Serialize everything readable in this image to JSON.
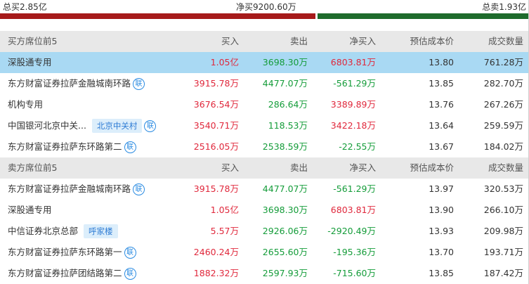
{
  "summary": {
    "total_buy": "总买2.85亿",
    "net_buy": "净买9200.60万",
    "total_sell": "总卖1.93亿",
    "buy_ratio": 0.596,
    "buy_color": "#a61a1a",
    "sell_color": "#1e6b2c"
  },
  "columns": {
    "buy": "买入",
    "sell": "卖出",
    "net": "净买入",
    "cost": "预估成本价",
    "vol": "成交数量"
  },
  "buy_section": {
    "title": "买方席位前5",
    "rows": [
      {
        "name": "深股通专用",
        "tag": "",
        "lian": false,
        "buy": "1.05亿",
        "sell": "3698.30万",
        "net": "6803.81万",
        "net_dir": "red",
        "cost": "13.80",
        "vol": "761.28万",
        "highlight": true
      },
      {
        "name": "东方财富证券拉萨金融城南环路",
        "tag": "",
        "lian": true,
        "buy": "3915.78万",
        "sell": "4477.07万",
        "net": "-561.29万",
        "net_dir": "green",
        "cost": "13.85",
        "vol": "282.70万",
        "highlight": false
      },
      {
        "name": "机构专用",
        "tag": "",
        "lian": false,
        "buy": "3676.54万",
        "sell": "286.64万",
        "net": "3389.89万",
        "net_dir": "red",
        "cost": "13.76",
        "vol": "267.26万",
        "highlight": false
      },
      {
        "name": "中国银河北京中关...",
        "tag": "北京中关村",
        "lian": true,
        "buy": "3540.71万",
        "sell": "118.53万",
        "net": "3422.18万",
        "net_dir": "red",
        "cost": "13.64",
        "vol": "259.59万",
        "highlight": false
      },
      {
        "name": "东方财富证券拉萨东环路第二",
        "tag": "",
        "lian": true,
        "buy": "2516.05万",
        "sell": "2538.59万",
        "net": "-22.55万",
        "net_dir": "green",
        "cost": "13.67",
        "vol": "184.02万",
        "highlight": false
      }
    ]
  },
  "sell_section": {
    "title": "卖方席位前5",
    "rows": [
      {
        "name": "东方财富证券拉萨金融城南环路",
        "tag": "",
        "lian": true,
        "buy": "3915.78万",
        "sell": "4477.07万",
        "net": "-561.29万",
        "net_dir": "green",
        "cost": "13.97",
        "vol": "320.53万",
        "highlight": false
      },
      {
        "name": "深股通专用",
        "tag": "",
        "lian": false,
        "buy": "1.05亿",
        "sell": "3698.30万",
        "net": "6803.81万",
        "net_dir": "red",
        "cost": "13.90",
        "vol": "266.10万",
        "highlight": false
      },
      {
        "name": "中信证券北京总部",
        "tag": "呼家楼",
        "lian": false,
        "buy": "5.57万",
        "sell": "2926.06万",
        "net": "-2920.49万",
        "net_dir": "green",
        "cost": "13.93",
        "vol": "209.98万",
        "highlight": false
      },
      {
        "name": "东方财富证券拉萨东环路第一",
        "tag": "",
        "lian": true,
        "buy": "2460.24万",
        "sell": "2655.60万",
        "net": "-195.36万",
        "net_dir": "green",
        "cost": "13.70",
        "vol": "193.71万",
        "highlight": false
      },
      {
        "name": "东方财富证券拉萨团结路第二",
        "tag": "",
        "lian": true,
        "buy": "1882.32万",
        "sell": "2597.93万",
        "net": "-715.60万",
        "net_dir": "green",
        "cost": "13.85",
        "vol": "187.42万",
        "highlight": false
      }
    ]
  },
  "lian_glyph": "联",
  "lian_icon": "lian-badge-icon"
}
